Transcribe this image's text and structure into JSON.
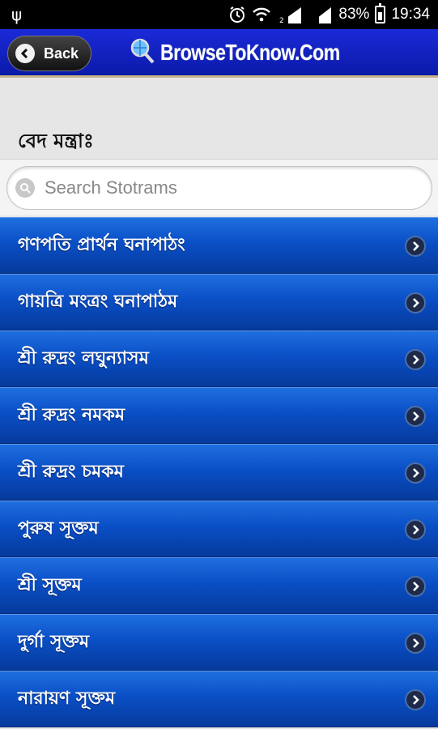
{
  "status_bar": {
    "usb_icon": "usb-icon",
    "battery_percent": "83%",
    "time": "19:34"
  },
  "header": {
    "back_label": "Back",
    "brand": "BrowseToKnow.Com",
    "bg_color": "#0b1aa8"
  },
  "page": {
    "title": "বেদ মন্ত্রাঃ"
  },
  "search": {
    "placeholder": "Search Stotrams"
  },
  "items": [
    {
      "label": "গণপতি প্রার্থন ঘনাপাঠং"
    },
    {
      "label": "গায়ত্রি মংত্রং ঘনাপাঠম"
    },
    {
      "label": "শ্রী রুদ্রং লঘুন্যাসম"
    },
    {
      "label": "শ্রী রুদ্রং নমকম"
    },
    {
      "label": "শ্রী রুদ্রং চমকম"
    },
    {
      "label": "পুরুষ সূক্তম"
    },
    {
      "label": "শ্রী সূক্তম"
    },
    {
      "label": "দুর্গা সূক্তম"
    },
    {
      "label": "নারায়ণ সূক্তম"
    }
  ]
}
